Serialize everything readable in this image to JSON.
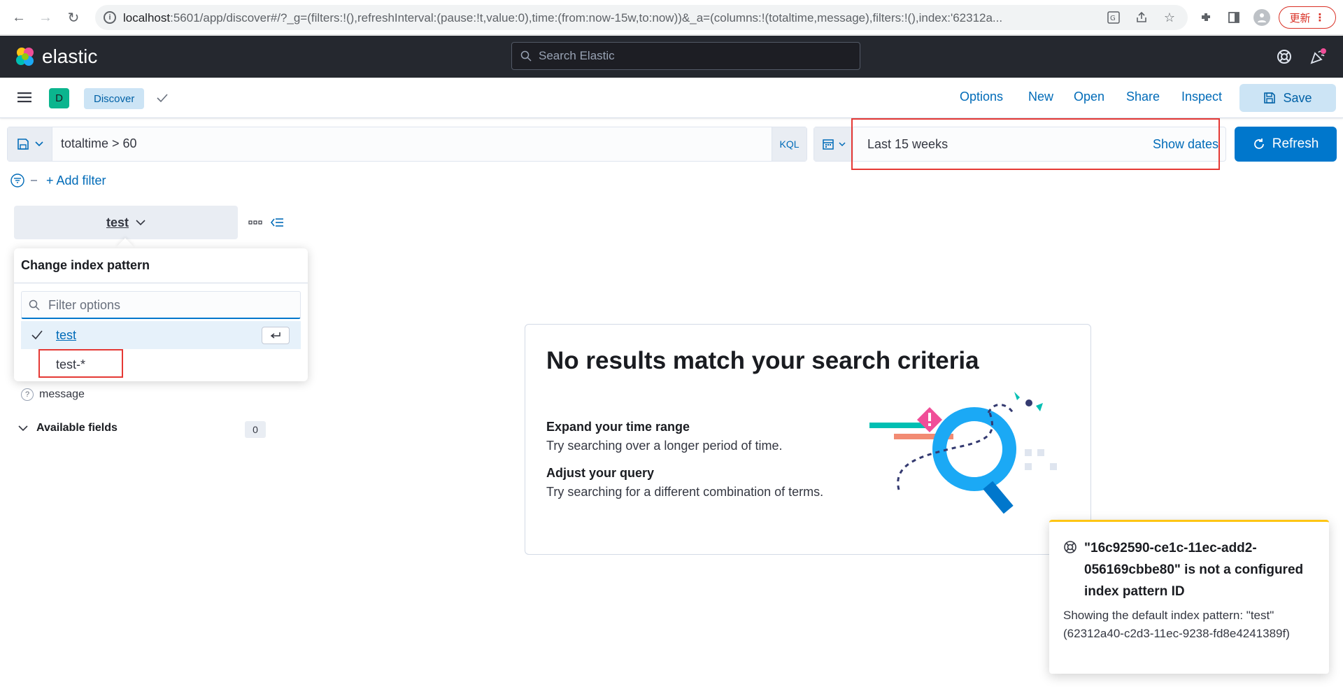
{
  "browser": {
    "url_host": "localhost",
    "url_rest": ":5601/app/discover#/?_g=(filters:!(),refreshInterval:(pause:!t,value:0),time:(from:now-15w,to:now))&_a=(columns:!(totaltime,message),filters:!(),index:'62312a...",
    "update_label": "更新"
  },
  "header": {
    "brand": "elastic",
    "search_placeholder": "Search Elastic"
  },
  "app_bar": {
    "space_initial": "D",
    "breadcrumb": "Discover",
    "links": [
      "Options",
      "New",
      "Open",
      "Share",
      "Inspect"
    ],
    "save_label": "Save"
  },
  "query": {
    "text": "totaltime > 60",
    "language": "KQL"
  },
  "time": {
    "label": "Last 15 weeks",
    "show_dates": "Show dates",
    "refresh_label": "Refresh"
  },
  "filters": {
    "add_label": "+ Add filter"
  },
  "index_pattern": {
    "selected": "test",
    "popover_title": "Change index pattern",
    "filter_placeholder": "Filter options",
    "options": [
      "test",
      "test-*"
    ]
  },
  "sidebar": {
    "selected_field": "message",
    "available_title": "Available fields",
    "available_count": "0"
  },
  "no_results": {
    "title": "No results match your search criteria",
    "tip1_title": "Expand your time range",
    "tip1_body": "Try searching over a longer period of time.",
    "tip2_title": "Adjust your query",
    "tip2_body": "Try searching for a different combination of terms."
  },
  "toast": {
    "title": "\"16c92590-ce1c-11ec-add2-056169cbbe80\" is not a configured index pattern ID",
    "body": "Showing the default index pattern: \"test\" (62312a40-c2d3-11ec-9238-fd8e4241389f)"
  },
  "colors": {
    "primary": "#0077cc",
    "header_bg": "#25282f",
    "highlight_red": "#e53935",
    "toast_warning": "#fec514"
  }
}
